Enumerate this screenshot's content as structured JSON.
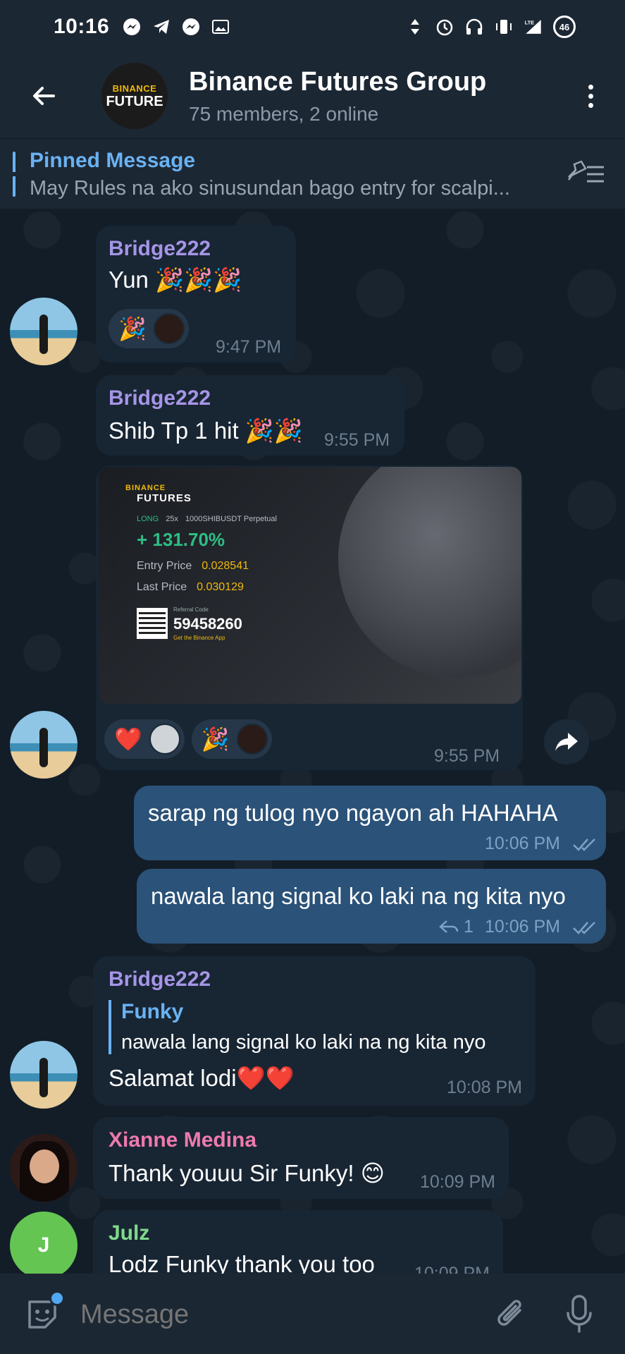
{
  "status_bar": {
    "time": "10:16",
    "network": "LTE",
    "battery": "46"
  },
  "header": {
    "title": "Binance Futures Group",
    "subtitle": "75 members, 2 online",
    "avatar_top": "BINANCE",
    "avatar_bottom": "FUTURE"
  },
  "pinned": {
    "title": "Pinned Message",
    "text": "May Rules na ako sinusundan bago entry for scalpi..."
  },
  "messages": {
    "m1": {
      "sender": "Bridge222",
      "text": "Yun 🎉🎉🎉",
      "time": "9:47 PM",
      "reaction": "🎉"
    },
    "m2": {
      "sender": "Bridge222",
      "text": "Shib Tp 1 hit 🎉🎉",
      "time": "9:55 PM"
    },
    "m3": {
      "time": "9:55 PM",
      "reaction_1": "❤️",
      "reaction_2": "🎉"
    },
    "m4": {
      "text": "sarap ng tulog nyo ngayon ah HAHAHA",
      "time": "10:06 PM"
    },
    "m5": {
      "text": "nawala lang signal ko laki na ng kita nyo",
      "time": "10:06 PM",
      "reply_count": "1"
    },
    "m6": {
      "sender": "Bridge222",
      "reply_name": "Funky",
      "reply_text": "nawala lang signal ko laki na ng kita nyo",
      "text": "Salamat lodi❤️❤️",
      "time": "10:08 PM"
    },
    "m7": {
      "sender": "Xianne Medina",
      "text": "Thank youuu Sir Funky! 😊",
      "time": "10:09 PM"
    },
    "m8": {
      "sender": "Julz",
      "initial": "J",
      "text": "Lodz Funky thank you too",
      "time": "10:09 PM"
    }
  },
  "card": {
    "brand_top": "BINANCE",
    "brand_bottom": "FUTURES",
    "side": "LONG",
    "leverage": "25x",
    "pair": "1000SHIBUSDT Perpetual",
    "pnl": "+ 131.70%",
    "entry_label": "Entry Price",
    "entry_value": "0.028541",
    "last_label": "Last Price",
    "last_value": "0.030129",
    "ref_label": "Referral Code",
    "ref_code": "59458260",
    "ref_app": "Get the Binance App"
  },
  "input": {
    "placeholder": "Message"
  },
  "colors": {
    "header_bg": "#1c2734",
    "incoming_bubble": "#182533",
    "outgoing_bubble": "#2b5278",
    "bridge_name": "#a695e7",
    "xianne_name": "#ee7aae",
    "julz_name": "#7fd98c",
    "accent": "#6ab2f2"
  }
}
